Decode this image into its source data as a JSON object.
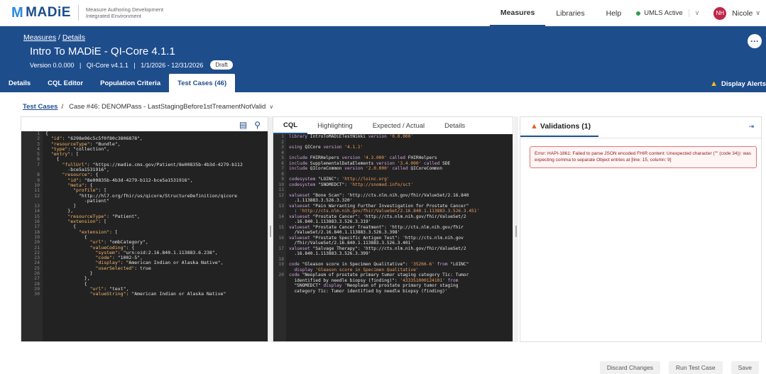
{
  "logo": {
    "text": "MADiE",
    "subtitle_line1": "Measure Authoring Development",
    "subtitle_line2": "Integrated Environment"
  },
  "topnav": {
    "links": [
      "Measures",
      "Libraries",
      "Help"
    ],
    "umls_status": "UMLS Active",
    "avatar_initials": "NH",
    "username": "Nicole"
  },
  "header": {
    "breadcrumb_measures": "Measures",
    "breadcrumb_sep": "/",
    "breadcrumb_details": "Details",
    "title": "Intro To MADiE - QI-Core 4.1.1",
    "meta": "Version 0.0.000   |   QI-Core v4.1.1   |   1/1/2026 - 12/31/2026",
    "status_badge": "Draft",
    "display_alerts": "Display Alerts"
  },
  "tabs": [
    "Details",
    "CQL Editor",
    "Population Criteria",
    "Test Cases (46)"
  ],
  "subcrumb": {
    "test_cases": "Test Cases",
    "sep": "/",
    "case_title": "Case #46: DENOMPass - LastStagingBefore1stTreamentNotValid"
  },
  "json_editor": {
    "line_numbers": [
      "1",
      "2",
      "3",
      "4",
      "5",
      "6",
      "7",
      "",
      "8",
      "9",
      "10",
      "11",
      "12",
      "",
      "13",
      "14",
      "15",
      "16",
      "17",
      "18",
      "19",
      "20",
      "21",
      "22",
      "23",
      "24",
      "25",
      "26",
      "27",
      "28",
      "29",
      "30"
    ],
    "lines": [
      "{",
      "  \"id\": \"6298e96c5c5f0f80c3806878\",",
      "  \"resourceType\": \"Bundle\",",
      "  \"type\": \"collection\",",
      "  \"entry\": [",
      "    {",
      "      \"fullUrl\": \"https://madie.cms.gov/Patient/8e00835b-4b3d-4279-b112",
      "        -bce5a1531916\",",
      "      \"resource\": {",
      "        \"id\": \"8e00835b-4b3d-4279-b112-bce5a1531916\",",
      "        \"meta\": {",
      "          \"profile\": [",
      "            \"http://hl7.org/fhir/us/qicore/StructureDefinition/qicore",
      "              -patient\"",
      "          ]",
      "        },",
      "        \"resourceType\": \"Patient\",",
      "        \"extension\": [",
      "          {",
      "            \"extension\": [",
      "              {",
      "                \"url\": \"ombCategory\",",
      "                \"valueCoding\": {",
      "                  \"system\": \"urn:oid:2.16.840.1.113883.6.238\",",
      "                  \"code\": \"1002-5\",",
      "                  \"display\": \"American Indian or Alaska Native\",",
      "                  \"userSelected\": true",
      "                }",
      "              },",
      "              {",
      "                \"url\": \"text\",",
      "                \"valueString\": \"American Indian or Alaska Native\""
    ]
  },
  "cql_tabs": [
    "CQL",
    "Highlighting",
    "Expected / Actual",
    "Details"
  ],
  "cql_editor": {
    "line_numbers": [
      "1",
      "2",
      "3",
      "4",
      "5",
      "6",
      "7",
      "8",
      "9",
      "10",
      "11",
      "12",
      "",
      "13",
      "",
      "14",
      "",
      "15",
      "",
      "16",
      "",
      "17",
      "",
      "18",
      "19",
      "",
      "20",
      "",
      ""
    ],
    "lines": [
      "library IntroToMADiETestNikki version '0.0.000'",
      "",
      "using QICore version '4.1.1'",
      "",
      "include FHIRHelpers version '4.3.000' called FHIRHelpers",
      "include SupplementalDataElements version '3.4.000' called SDE",
      "include QICoreCommon version '2.0.000' called QICoreCommon",
      "",
      "codesystem \"LOINC\": 'http://loinc.org'",
      "codesystem \"SNOMEDCT\": 'http://snomed.info/sct'",
      "",
      "valueset \"Bone Scan\": 'http://cts.nlm.nih.gov/fhir/ValueSet/2.16.840",
      "  .1.113883.3.526.3.320'",
      "valueset \"Pain Warranting Further Investigation for Prostate Cancer\"",
      "  : 'http://cts.nlm.nih.gov/fhir/ValueSet/2.16.840.1.113883.3.526.3.451'",
      "valueset \"Prostate Cancer\": 'http://cts.nlm.nih.gov/fhir/ValueSet/2",
      "  .16.840.1.113883.3.526.3.319'",
      "valueset \"Prostate Cancer Treatment\": 'http://cts.nlm.nih.gov/fhir",
      "  /ValueSet/2.16.840.1.113883.3.526.3.398'",
      "valueset \"Prostate Specific Antigen Test\": 'http://cts.nlm.nih.gov",
      "  /fhir/ValueSet/2.16.840.1.113883.3.526.3.401'",
      "valueset \"Salvage Therapy\": 'http://cts.nlm.nih.gov/fhir/ValueSet/2",
      "  .16.840.1.113883.3.526.3.399'",
      "",
      "code \"Gleason score in Specimen Qualitative\": '35266-6' from \"LOINC\"",
      "  display 'Gleason score in Specimen Qualitative'",
      "code \"Neoplasm of prostate primary tumor staging category T1c: Tumor",
      "  identified by needle biopsy (finding)\": '433351000124101' from",
      "  \"SNOMEDCT\" display 'Neoplasm of prostate primary tumor staging",
      "  category T1c: Tumor identified by needle biopsy (finding)'"
    ]
  },
  "validations": {
    "tab_label": "Validations (1)",
    "error_text": "Error: HAPI-1861: Failed to parse JSON encoded FHIR content: Unexpected character ('\"' (code 34)): was expecting comma to separate Object entries at [line: 15, column: 9]"
  },
  "footer": {
    "discard": "Discard Changes",
    "run": "Run Test Case",
    "save": "Save"
  },
  "colors": {
    "brand": "#1e4d8c",
    "error": "#e57373",
    "warning": "#f4c600",
    "status_ok": "#2e9d4a"
  }
}
